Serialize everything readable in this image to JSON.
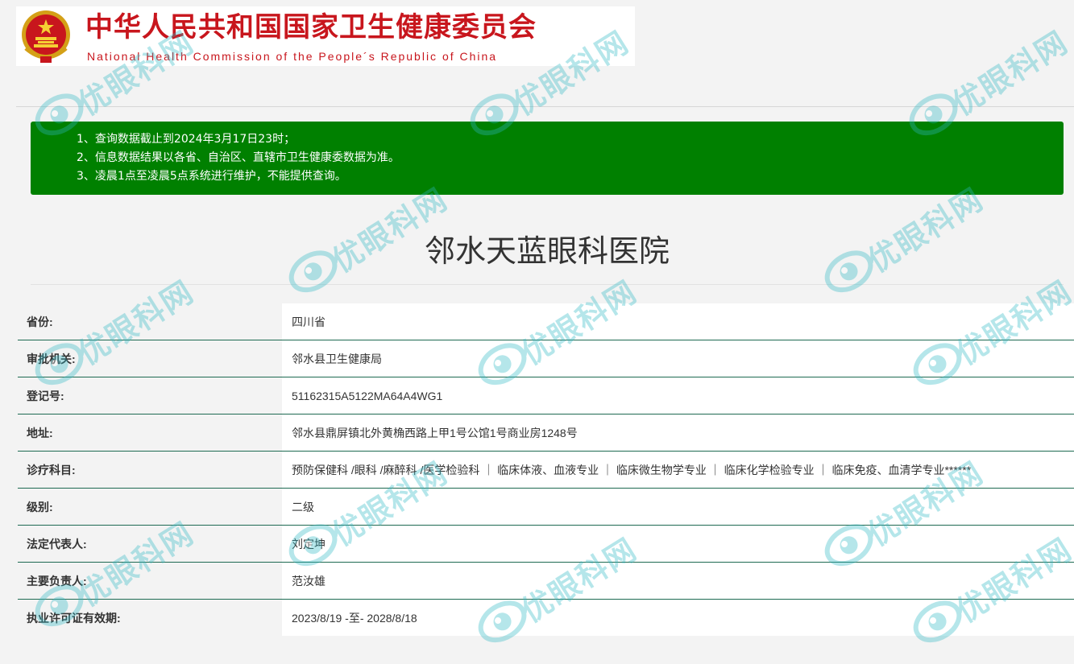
{
  "header": {
    "cn_title": "中华人民共和国国家卫生健康委员会",
    "en_title": "National Health Commission of the People´s Republic of China",
    "emblem_icon": "national-emblem-icon",
    "brand_color": "#c8161d"
  },
  "notice": {
    "lines": [
      "1、查询数据截止到2024年3月17日23时；",
      "2、信息数据结果以各省、自治区、直辖市卫生健康委数据为准。",
      "3、凌晨1点至凌晨5点系统进行维护，不能提供查询。"
    ],
    "background": "#008000"
  },
  "hospital": {
    "name": "邻水天蓝眼科医院"
  },
  "info": {
    "rows": [
      {
        "label": "省份:",
        "value": "四川省"
      },
      {
        "label": "审批机关:",
        "value": "邻水县卫生健康局"
      },
      {
        "label": "登记号:",
        "value": "51162315A5122MA64A4WG1"
      },
      {
        "label": "地址:",
        "value": "邻水县鼎屏镇北外黄桷西路上甲1号公馆1号商业房1248号"
      },
      {
        "label": "诊疗科目:",
        "value": "预防保健科 /眼科 /麻醉科 /医学检验科 ｜ 临床体液、血液专业 ｜ 临床微生物学专业 ｜ 临床化学检验专业 ｜ 临床免疫、血清学专业******"
      },
      {
        "label": "级别:",
        "value": "二级"
      },
      {
        "label": "法定代表人:",
        "value": "刘定坤"
      },
      {
        "label": "主要负责人:",
        "value": "范汝雄"
      },
      {
        "label": "执业许可证有效期:",
        "value": "2023/8/19 -至- 2028/8/18"
      }
    ],
    "row_border_color": "#1e6a52"
  },
  "watermark": {
    "text": "优眼科网",
    "icon": "eye-logo-icon",
    "color": "#2fb8c4"
  }
}
